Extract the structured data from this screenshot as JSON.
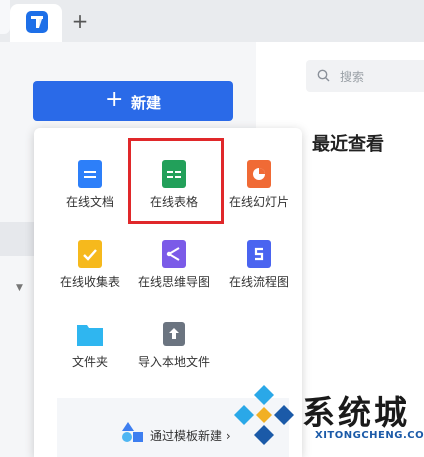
{
  "tabs": {
    "active_icon": "app-logo-icon",
    "new_tab_label": "+"
  },
  "sidebar": {
    "new_button": {
      "icon": "plus-icon",
      "plus": "+",
      "label": "新建"
    }
  },
  "search": {
    "placeholder": "搜索"
  },
  "main": {
    "heading": "最近查看"
  },
  "new_menu": {
    "items": [
      {
        "label": "在线文档",
        "icon": "doc-icon",
        "color": "#2d7ff9"
      },
      {
        "label": "在线表格",
        "icon": "sheet-icon",
        "color": "#22a05a",
        "highlighted": true
      },
      {
        "label": "在线幻灯片",
        "icon": "slides-icon",
        "color": "#f06a35"
      },
      {
        "label": "在线收集表",
        "icon": "form-icon",
        "color": "#f6b91c"
      },
      {
        "label": "在线思维导图",
        "icon": "mindmap-icon",
        "color": "#7b5be8"
      },
      {
        "label": "在线流程图",
        "icon": "flowchart-icon",
        "color": "#4a64f0"
      },
      {
        "label": "文件夹",
        "icon": "folder-icon",
        "color": "#2fb6f0"
      },
      {
        "label": "导入本地文件",
        "icon": "upload-icon",
        "color": "#6b7480"
      }
    ],
    "template_link": "通过模板新建 ›"
  },
  "watermark": {
    "text": "系统城",
    "url": "XITONGCHENG.COM"
  }
}
